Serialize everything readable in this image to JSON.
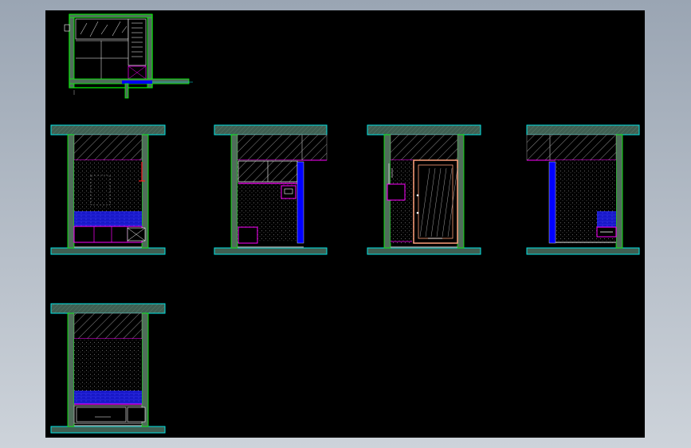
{
  "app": {
    "background_top": "#9aa5b3",
    "background_bottom": "#cdd3da",
    "canvas_color": "#000000"
  },
  "drawing": {
    "colors": {
      "wall": "#4f6d5a",
      "wall_outline": "#00ff00",
      "floor_slab": "#3f5f52",
      "slab_outline": "#00e5e5",
      "hatch": "#8a8a8a",
      "ceiling_frame": "#ff00ff",
      "wall_dots": "#7a7a7a",
      "pillar": "#0000ff",
      "tile_band": "#1818c8",
      "cabinet": "#ff00ff",
      "door_frame": "#ffa07a",
      "glass": "#a0a0a0",
      "red_detail": "#ff2020",
      "white_detail": "#ffffff",
      "grey_line": "#9a9a9a"
    },
    "views": [
      {
        "id": "plan",
        "kind": "floor-plan",
        "icon": "floor-plan-icon"
      },
      {
        "id": "elevation-a",
        "kind": "elevation",
        "icon": "elevation-icon"
      },
      {
        "id": "elevation-b",
        "kind": "elevation",
        "icon": "elevation-icon"
      },
      {
        "id": "elevation-c",
        "kind": "elevation",
        "icon": "elevation-icon"
      },
      {
        "id": "elevation-d",
        "kind": "elevation",
        "icon": "elevation-icon"
      },
      {
        "id": "elevation-e",
        "kind": "elevation",
        "icon": "elevation-icon"
      }
    ]
  }
}
